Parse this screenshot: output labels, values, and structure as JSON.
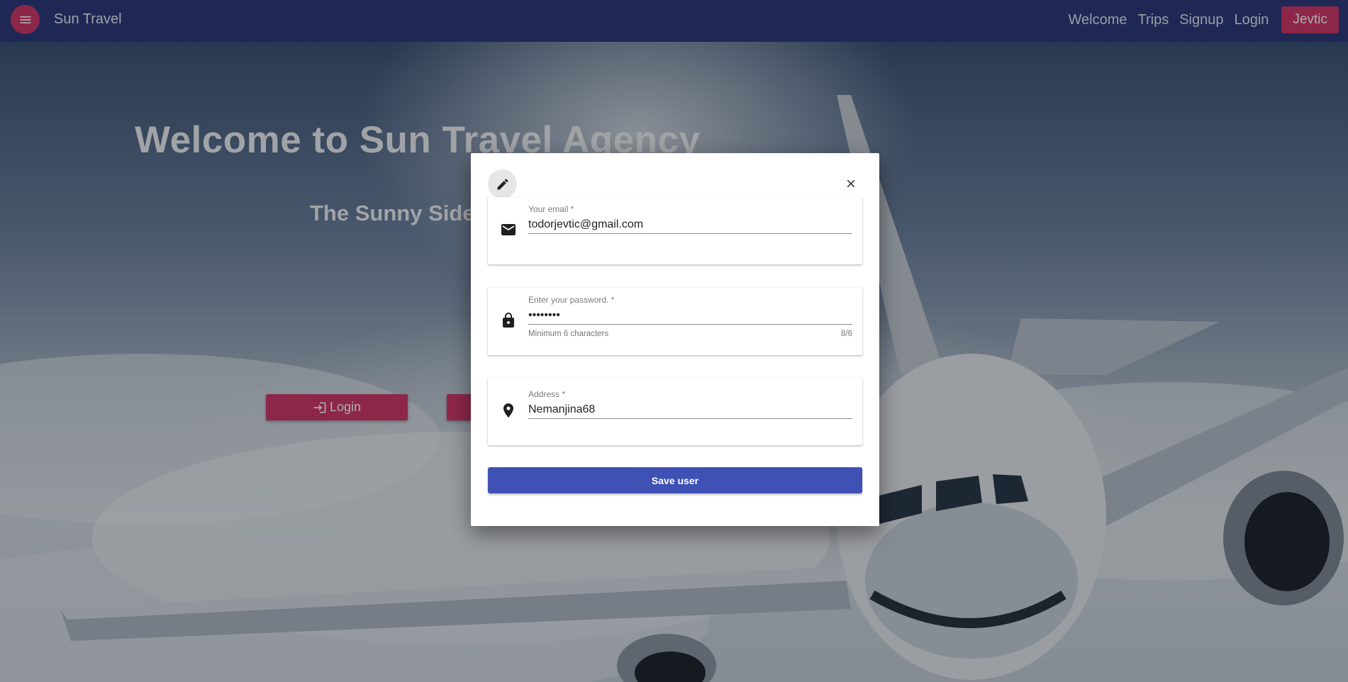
{
  "navbar": {
    "brand": "Sun Travel",
    "links": [
      "Welcome",
      "Trips",
      "Signup",
      "Login"
    ],
    "user_button": "Jevtic"
  },
  "hero": {
    "title": "Welcome to Sun Travel Agency",
    "subtitle": "The Sunny Side",
    "login_button": "Login"
  },
  "dialog": {
    "email": {
      "label": "Your email *",
      "value": "todorjevtic@gmail.com"
    },
    "password": {
      "label": "Enter your password. *",
      "value": "••••••••",
      "hint": "Minimum 6 characters",
      "counter": "8/6"
    },
    "address": {
      "label": "Address *",
      "value": "Nemanjina68"
    },
    "save_button": "Save user"
  },
  "colors": {
    "navbar": "#2e3b7e",
    "accent": "#d03a6c",
    "primary_button": "#3f51b5"
  },
  "icons": [
    "menu-icon",
    "edit-icon",
    "close-icon",
    "email-icon",
    "lock-icon",
    "location-icon",
    "login-icon"
  ]
}
